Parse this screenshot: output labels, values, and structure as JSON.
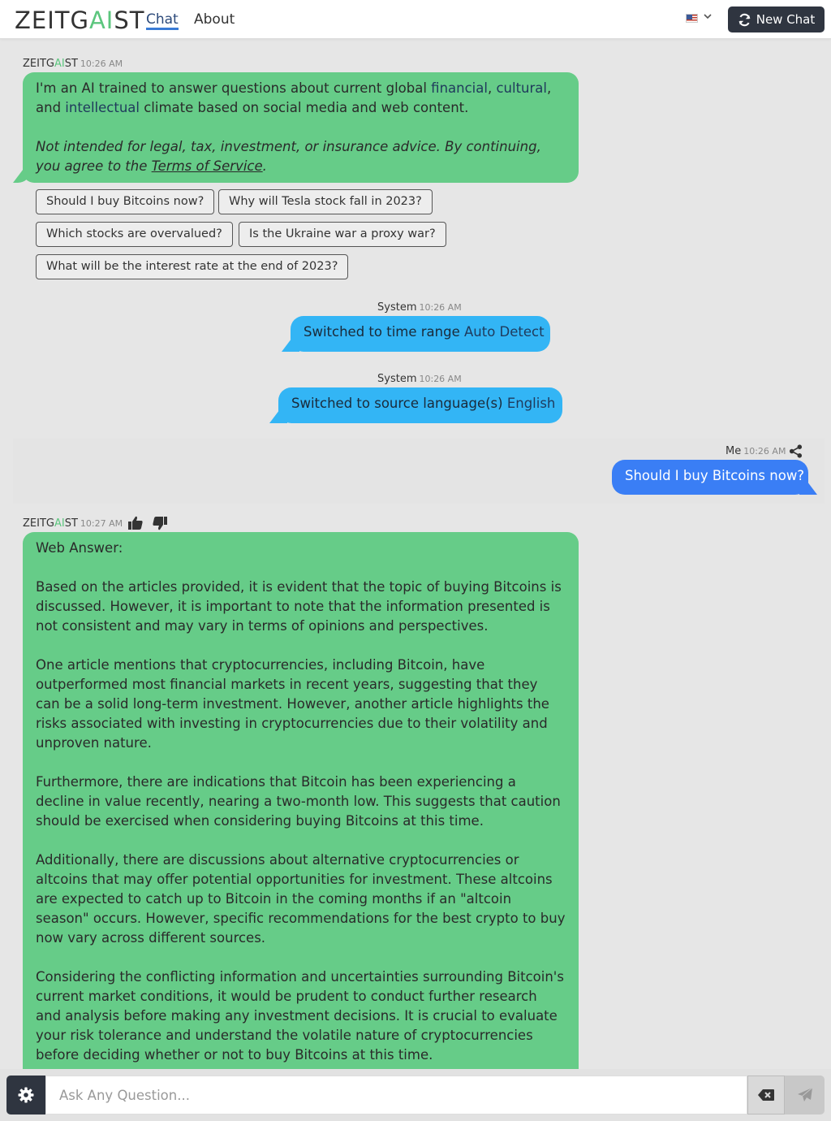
{
  "header": {
    "logo_pre": "ZEITG",
    "logo_ai": "AI",
    "logo_post": "ST",
    "nav": {
      "chat": "Chat",
      "about": "About"
    },
    "language_flag": "us-flag-icon",
    "new_chat_label": "New Chat"
  },
  "messages": {
    "intro": {
      "sender_pre": "ZEITG",
      "sender_ai": "AI",
      "sender_post": "ST",
      "time": "10:26 AM",
      "text_1": "I'm an AI trained to answer questions about current global ",
      "hl_financial": "financial",
      "comma_1": ", ",
      "hl_cultural": "cultural",
      "text_2": ", and",
      "hl_intellectual": "intellectual",
      "text_3": " climate based on social media and web content.",
      "disclaimer": "Not intended for legal, tax, investment, or insurance advice. By continuing, you agree to the ",
      "tos_link": "Terms of Service",
      "disclaimer_end": "."
    },
    "suggestions": [
      "Should I buy Bitcoins now?",
      "Why will Tesla stock fall in 2023?",
      "Which stocks are overvalued?",
      "Is the Ukraine war a proxy war?",
      "What will be the interest rate at the end of 2023?"
    ],
    "system_1": {
      "sender": "System",
      "time": "10:26 AM",
      "text": "Switched to time range ",
      "value": "Auto Detect"
    },
    "system_2": {
      "sender": "System",
      "time": "10:26 AM",
      "text": "Switched to source language(s) ",
      "value": "English"
    },
    "user_1": {
      "sender": "Me",
      "time": "10:26 AM",
      "text": "Should I buy Bitcoins now?"
    },
    "answer": {
      "sender_pre": "ZEITG",
      "sender_ai": "AI",
      "sender_post": "ST",
      "time": "10:27 AM",
      "heading": "Web Answer:",
      "paragraphs": [
        "Based on the articles provided, it is evident that the topic of buying Bitcoins is discussed. However, it is important to note that the information presented is not consistent and may vary in terms of opinions and perspectives.",
        "One article mentions that cryptocurrencies, including Bitcoin, have outperformed most financial markets in recent years, suggesting that they can be a solid long-term investment. However, another article highlights the risks associated with investing in cryptocurrencies due to their volatility and unproven nature.",
        "Furthermore, there are indications that Bitcoin has been experiencing a decline in value recently, nearing a two-month low. This suggests that caution should be exercised when considering buying Bitcoins at this time.",
        "Additionally, there are discussions about alternative cryptocurrencies or altcoins that may offer potential opportunities for investment. These altcoins are expected to catch up to Bitcoin in the coming months if an \"altcoin season\" occurs. However, specific recommendations for the best crypto to buy now vary across different sources.",
        "Considering the conflicting information and uncertainties surrounding Bitcoin's current market conditions, it would be prudent to conduct further research and analysis before making any investment decisions. It is crucial to evaluate your risk tolerance and understand the volatile nature of cryptocurrencies before deciding whether or not to buy Bitcoins at this time."
      ]
    }
  },
  "input": {
    "placeholder": "Ask Any Question..."
  },
  "colors": {
    "ai_bubble": "#66cc88",
    "system_bubble": "#33b5f5",
    "user_bubble": "#3a7ef5",
    "dark_button": "#2f3540"
  }
}
